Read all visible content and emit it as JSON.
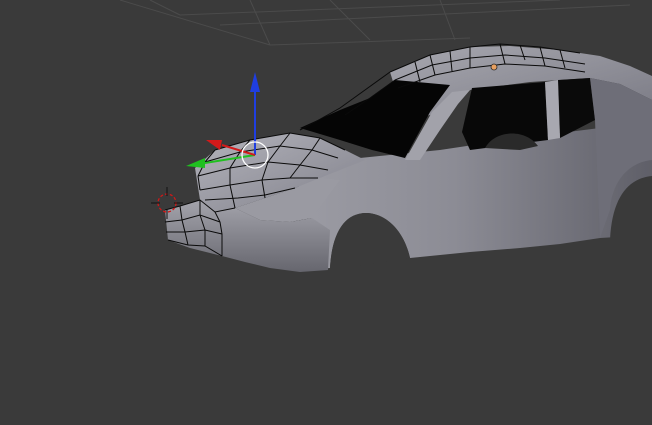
{
  "viewport": {
    "background_color": "#3a3a3a",
    "grid_color": "#4c4c4c",
    "body_color": "#8f8f97",
    "wire_color": "#101010",
    "axis_colors": {
      "x": "#d31a1a",
      "y": "#20c020",
      "z": "#1f3ee0"
    },
    "origin_dot_color": "#e8a060",
    "cursor_color": "#d01818"
  },
  "icons": {
    "cursor": "3d-cursor-icon",
    "transform_gizmo": "transform-manipulator-icon",
    "origin": "object-origin-icon"
  }
}
